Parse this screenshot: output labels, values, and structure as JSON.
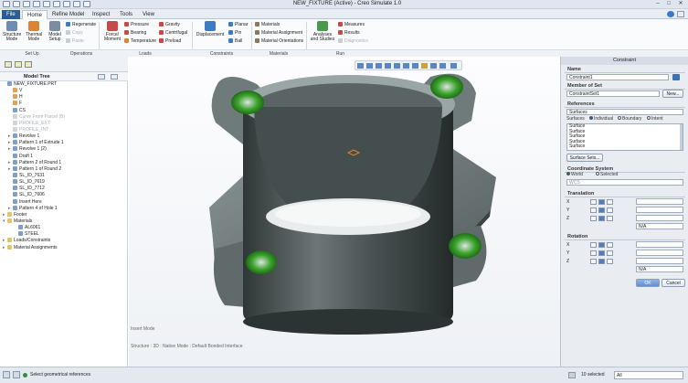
{
  "window": {
    "title": "NEW_FIXTURE (Active) - Creo Simulate 1.0"
  },
  "menu_tabs": [
    "File",
    "Home",
    "Refine Model",
    "Inspect",
    "Tools",
    "View"
  ],
  "ribbon": {
    "mode": {
      "structure": "Structure Mode",
      "thermal": "Thermal Mode",
      "setup": "Model Setup"
    },
    "setup_col": {
      "regenerate": "Regenerate",
      "copy": "Copy",
      "paste": "Paste"
    },
    "loads": {
      "force": "Force/ Moment",
      "pressure": "Pressure",
      "bearing": "Bearing",
      "temperature": "Temperature",
      "gravity": "Gravity",
      "centrifugal": "Centrifugal",
      "preload": "Preload"
    },
    "constraints": {
      "displacement": "Displacement",
      "planar": "Planar",
      "pin": "Pin",
      "ball": "Ball"
    },
    "materials": {
      "materials": "Materials",
      "assignment": "Material Assignment",
      "orientations": "Material Orientations"
    },
    "run": {
      "analyses": "Analyses and Studies",
      "measures": "Measures",
      "results": "Results",
      "diagnostics": "Diagnostics"
    },
    "groups": {
      "setup": "Set Up",
      "operations": "Operations",
      "loads": "Loads",
      "constraints": "Constraints",
      "materials": "Materials",
      "run": "Run"
    }
  },
  "tree": {
    "title": "Model Tree",
    "items": [
      {
        "label": "NEW_FIXTURE.PRT",
        "icon": "part-icon",
        "indent": 0,
        "expander": "",
        "dim": false
      },
      {
        "label": "V",
        "icon": "plane-icon",
        "indent": 1,
        "expander": "",
        "dim": false
      },
      {
        "label": "H",
        "icon": "plane-icon",
        "indent": 1,
        "expander": "",
        "dim": false
      },
      {
        "label": "F",
        "icon": "plane-icon",
        "indent": 1,
        "expander": "",
        "dim": false
      },
      {
        "label": "CS",
        "icon": "csys-icon",
        "indent": 1,
        "expander": "",
        "dim": false
      },
      {
        "label": "Curve From Parcel (B)",
        "icon": "curve-icon",
        "indent": 1,
        "expander": "",
        "dim": true
      },
      {
        "label": "PROFILE_EXT",
        "icon": "sketch-icon",
        "indent": 1,
        "expander": "",
        "dim": true
      },
      {
        "label": "PROFILE_INT",
        "icon": "sketch-icon",
        "indent": 1,
        "expander": "",
        "dim": true
      },
      {
        "label": "Revolve 1",
        "icon": "revolve-icon",
        "indent": 1,
        "expander": "▸",
        "dim": false
      },
      {
        "label": "Pattern 1 of Extrude 1",
        "icon": "pattern-icon",
        "indent": 1,
        "expander": "▸",
        "dim": false
      },
      {
        "label": "Revolve 1 (2)",
        "icon": "revolve-icon",
        "indent": 1,
        "expander": "▸",
        "dim": false
      },
      {
        "label": "Draft 1",
        "icon": "draft-icon",
        "indent": 1,
        "expander": "",
        "dim": false
      },
      {
        "label": "Pattern 2 of Round 1",
        "icon": "pattern-icon",
        "indent": 1,
        "expander": "▸",
        "dim": false
      },
      {
        "label": "Pattern 1 of Round 2",
        "icon": "pattern-icon",
        "indent": 1,
        "expander": "▸",
        "dim": false
      },
      {
        "label": "SL_ID_7631",
        "icon": "surface-icon",
        "indent": 1,
        "expander": "",
        "dim": false
      },
      {
        "label": "SL_ID_7619",
        "icon": "surface-icon",
        "indent": 1,
        "expander": "",
        "dim": false
      },
      {
        "label": "SL_ID_7712",
        "icon": "surface-icon",
        "indent": 1,
        "expander": "",
        "dim": false
      },
      {
        "label": "SL_ID_7606",
        "icon": "surface-icon",
        "indent": 1,
        "expander": "",
        "dim": false
      },
      {
        "label": "Insert Here",
        "icon": "insert-icon",
        "indent": 1,
        "expander": "",
        "dim": false
      },
      {
        "label": "Pattern 4 of Hole 1",
        "icon": "pattern-icon",
        "indent": 1,
        "expander": "▸",
        "dim": false
      },
      {
        "label": "Footer",
        "icon": "folder-icon",
        "indent": 0,
        "expander": "▸",
        "dim": false
      },
      {
        "label": "Materials",
        "icon": "folder-icon",
        "indent": 0,
        "expander": "▾",
        "dim": false
      },
      {
        "label": "AL6061",
        "icon": "material-icon",
        "indent": 2,
        "expander": "",
        "dim": false
      },
      {
        "label": "STEEL",
        "icon": "material-icon",
        "indent": 2,
        "expander": "",
        "dim": false
      },
      {
        "label": "Loads/Constraints",
        "icon": "folder-icon",
        "indent": 0,
        "expander": "▸",
        "dim": false
      },
      {
        "label": "Material Assignments",
        "icon": "folder-icon",
        "indent": 0,
        "expander": "▸",
        "dim": false
      }
    ]
  },
  "viewport": {
    "mode": "Insert Mode",
    "info": "Structure : 3D : Native Mode : Default Bonded Interface"
  },
  "panel": {
    "title": "Constraint",
    "name_label": "Name",
    "name_value": "Constraint1",
    "member_label": "Member of Set",
    "member_value": "ConstraintSet1",
    "new_button": "New...",
    "refs_label": "References",
    "refs_value": "Surfaces",
    "surfaces_label": "Surfaces",
    "opt_individual": "Individual",
    "opt_boundary": "Boundary",
    "opt_intent": "Intent",
    "surface_list": [
      "Surface",
      "Surface",
      "Surface",
      "Surface",
      "Surface"
    ],
    "surface_sets": "Surface Sets...",
    "coord_label": "Coordinate System",
    "opt_world": "World",
    "opt_selected": "Selected",
    "coord_value": "WCS",
    "translation_label": "Translation",
    "rotation_label": "Rotation",
    "axes": [
      "X",
      "Y",
      "Z"
    ],
    "na": "N/A",
    "ok": "OK",
    "cancel": "Cancel"
  },
  "status": {
    "message": "Select geometrical references",
    "selected": "10 selected",
    "filter": "All"
  }
}
